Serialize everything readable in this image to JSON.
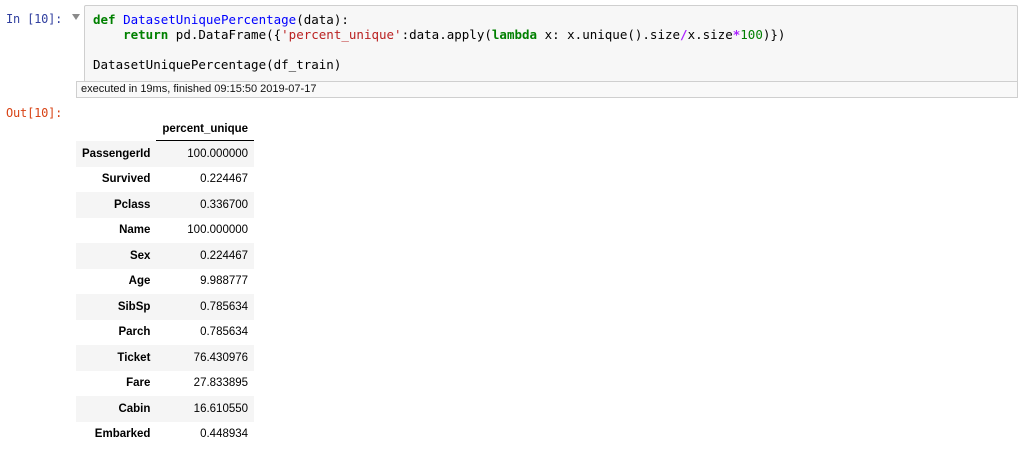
{
  "cell": {
    "input_prompt": "In [10]:",
    "output_prompt": "Out[10]:",
    "code_lines": [
      [
        {
          "t": "kw",
          "v": "def"
        },
        {
          "t": "plain",
          "v": " "
        },
        {
          "t": "fn",
          "v": "DatasetUniquePercentage"
        },
        {
          "t": "plain",
          "v": "(data):"
        }
      ],
      [
        {
          "t": "plain",
          "v": "    "
        },
        {
          "t": "kw",
          "v": "return"
        },
        {
          "t": "plain",
          "v": " pd.DataFrame({"
        },
        {
          "t": "str",
          "v": "'percent_unique'"
        },
        {
          "t": "plain",
          "v": ":data.apply("
        },
        {
          "t": "kw",
          "v": "lambda"
        },
        {
          "t": "plain",
          "v": " x: x.unique().size"
        },
        {
          "t": "op",
          "v": "/"
        },
        {
          "t": "plain",
          "v": "x.size"
        },
        {
          "t": "op",
          "v": "*"
        },
        {
          "t": "num",
          "v": "100"
        },
        {
          "t": "plain",
          "v": ")})"
        }
      ],
      [],
      [
        {
          "t": "plain",
          "v": "DatasetUniquePercentage(df_train)"
        }
      ]
    ],
    "execution_status": "executed in 19ms, finished 09:15:50 2019-07-17"
  },
  "output_table": {
    "column_header": "percent_unique",
    "rows": [
      {
        "index": "PassengerId",
        "value": "100.000000"
      },
      {
        "index": "Survived",
        "value": "0.224467"
      },
      {
        "index": "Pclass",
        "value": "0.336700"
      },
      {
        "index": "Name",
        "value": "100.000000"
      },
      {
        "index": "Sex",
        "value": "0.224467"
      },
      {
        "index": "Age",
        "value": "9.988777"
      },
      {
        "index": "SibSp",
        "value": "0.785634"
      },
      {
        "index": "Parch",
        "value": "0.785634"
      },
      {
        "index": "Ticket",
        "value": "76.430976"
      },
      {
        "index": "Fare",
        "value": "27.833895"
      },
      {
        "index": "Cabin",
        "value": "16.610550"
      },
      {
        "index": "Embarked",
        "value": "0.448934"
      }
    ]
  },
  "icons": {
    "collapse_toggle": "triangle-down-icon"
  },
  "colors": {
    "input_prompt": "#303f9f",
    "output_prompt": "#d84315",
    "keyword": "#008000",
    "function_name": "#0000ff",
    "string": "#ba2121",
    "operator": "#aa22ff"
  }
}
